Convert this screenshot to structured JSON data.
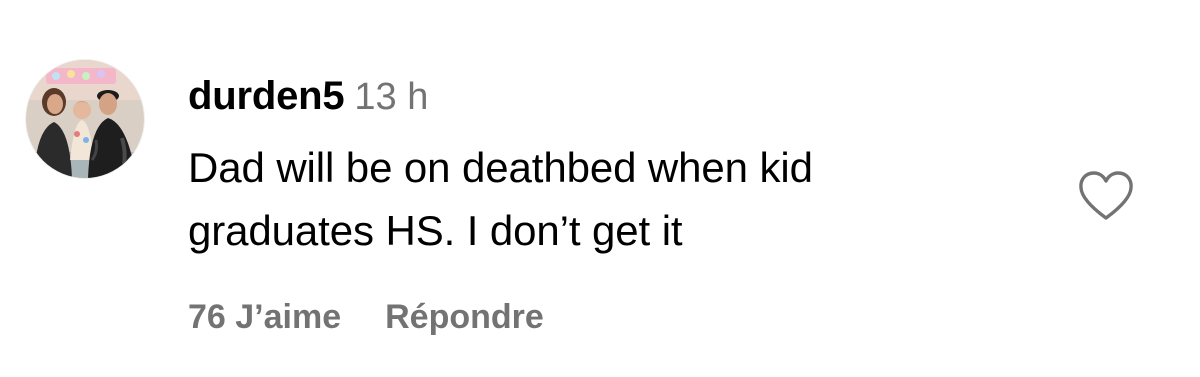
{
  "comment": {
    "username": "durden5",
    "timestamp": "13 h",
    "text_line_1": "Dad will be on deathbed when kid",
    "text_line_2": "graduates HS. I don’t get it",
    "likes_label": "76 J’aime",
    "reply_label": "Répondre",
    "like_icon": "heart-outline-icon",
    "avatar_icon": "profile-photo"
  },
  "colors": {
    "primary_text": "#000000",
    "secondary_text": "#737373",
    "icon_stroke": "#737373"
  }
}
